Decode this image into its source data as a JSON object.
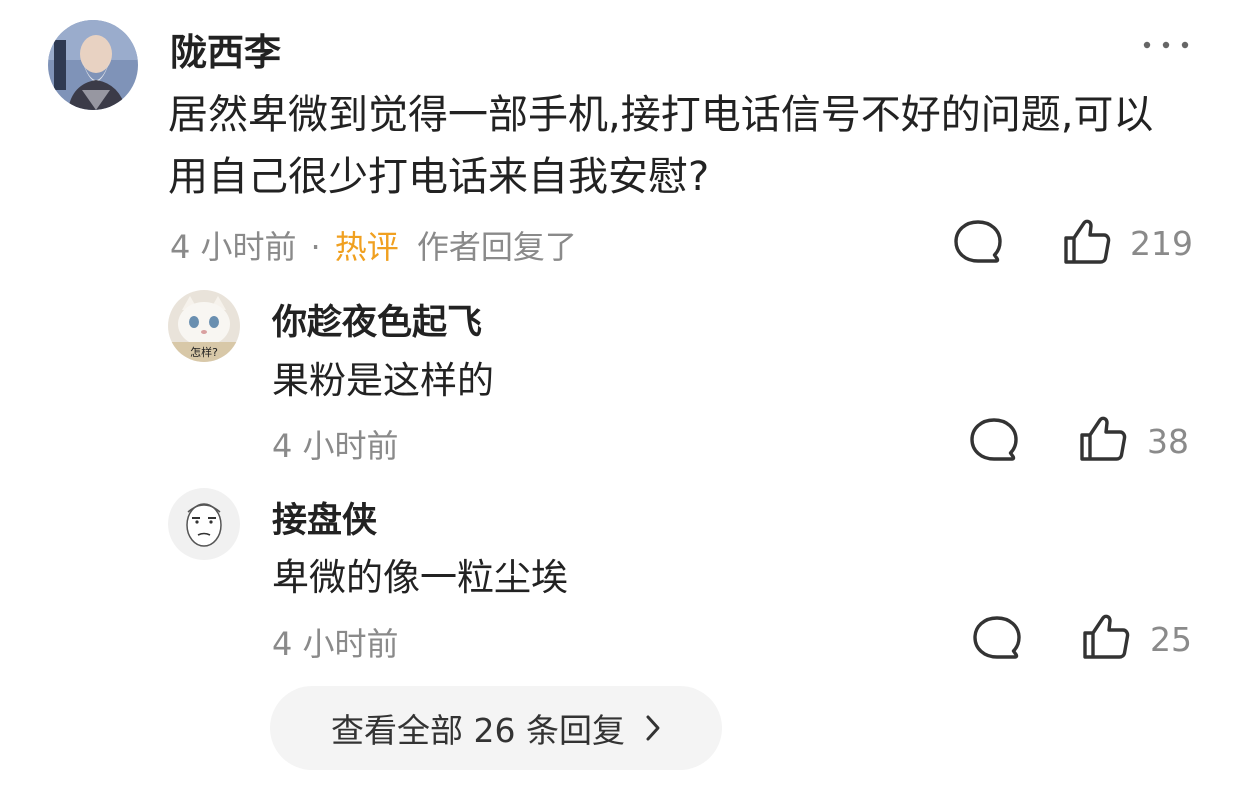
{
  "main_comment": {
    "author": "陇西李",
    "text": "居然卑微到觉得一部手机,接打电话信号不好的问题,可以用自己很少打电话来自我安慰?",
    "time": "4 小时前",
    "separator": "·",
    "hot_badge": "热评",
    "author_replied": "作者回复了",
    "like_count": "219",
    "avatar_icon": "elderly-man-portrait-avatar",
    "more_icon": "more-dots-icon"
  },
  "replies": [
    {
      "author": "你趁夜色起飞",
      "text": "果粉是这样的",
      "time": "4 小时前",
      "like_count": "38",
      "avatar_icon": "white-cat-avatar",
      "avatar_caption": "怎样?"
    },
    {
      "author": "接盘侠",
      "text": "卑微的像一粒尘埃",
      "time": "4 小时前",
      "like_count": "25",
      "avatar_icon": "meme-face-avatar"
    }
  ],
  "view_all": {
    "label": "查看全部 26 条回复",
    "icon": "chevron-right-icon"
  },
  "colors": {
    "text": "#222222",
    "meta": "#8a8a8a",
    "hot": "#f0a020",
    "button_bg": "#f4f4f4"
  }
}
